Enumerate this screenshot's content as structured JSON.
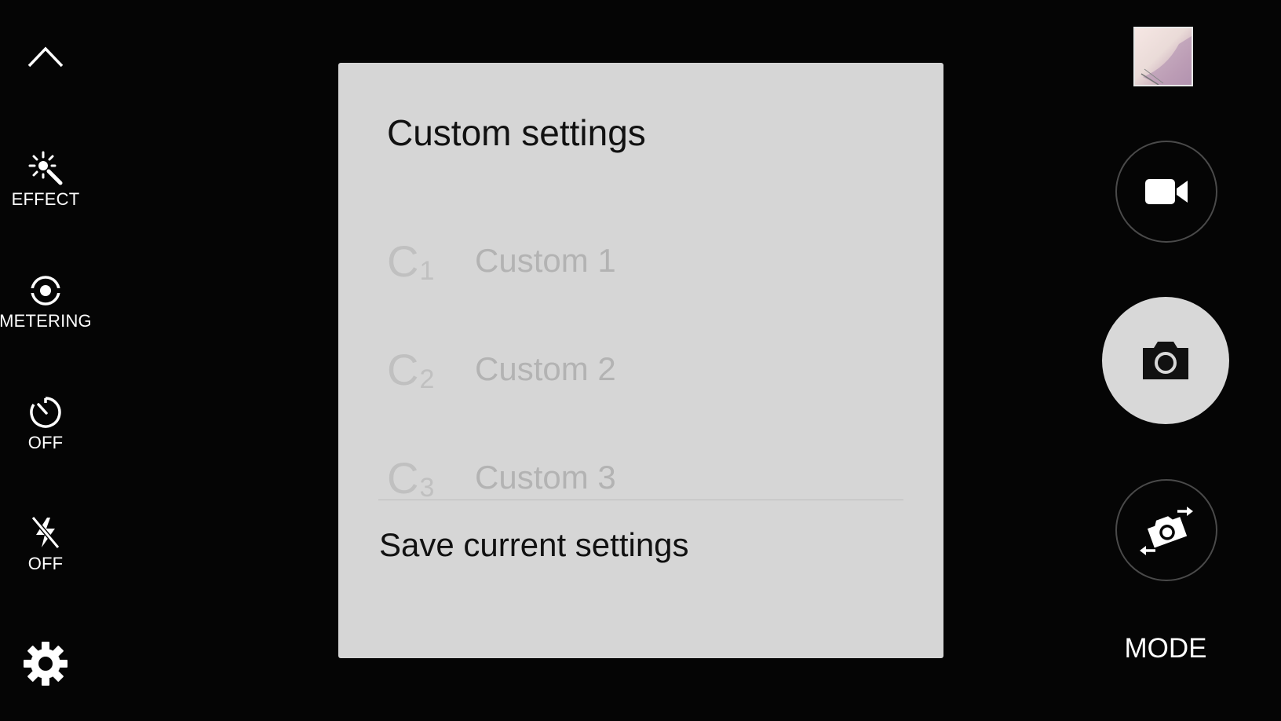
{
  "left_toolbar": {
    "effect_label": "EFFECT",
    "metering_label": "METERING",
    "timer_label": "OFF",
    "flash_label": "OFF"
  },
  "dialog": {
    "title": "Custom settings",
    "options": [
      {
        "badge_letter": "C",
        "badge_number": "1",
        "label": "Custom 1"
      },
      {
        "badge_letter": "C",
        "badge_number": "2",
        "label": "Custom 2"
      },
      {
        "badge_letter": "C",
        "badge_number": "3",
        "label": "Custom 3"
      }
    ],
    "save_action": "Save current settings"
  },
  "right_controls": {
    "mode_label": "MODE"
  },
  "icons": {
    "collapse": "chevron-up-icon",
    "effect": "magic-wand-icon",
    "metering": "metering-icon",
    "timer": "timer-icon",
    "flash": "flash-off-icon",
    "settings": "gear-icon",
    "record": "video-camera-icon",
    "shutter": "camera-icon",
    "switch": "switch-camera-icon"
  },
  "colors": {
    "background": "#050505",
    "dialog_bg": "#d6d6d6",
    "disabled_text": "#b3b3b3",
    "primary_text": "#111111"
  }
}
